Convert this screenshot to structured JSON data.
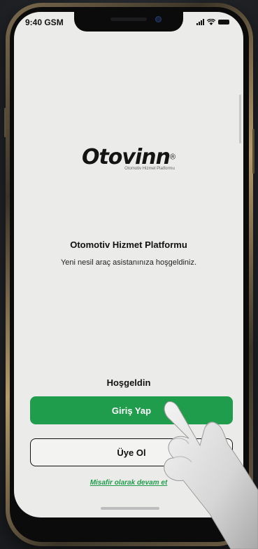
{
  "status_bar": {
    "time": "9:40 GSM"
  },
  "brand": {
    "logo_text": "Otovinn",
    "registered_mark": "®",
    "tagline": "Otomotiv Hizmet Platformu"
  },
  "intro": {
    "title": "Otomotiv Hizmet Platformu",
    "subtitle": "Yeni nesil araç asistanınıza hoşgeldiniz."
  },
  "actions": {
    "welcome_label": "Hoşgeldin",
    "login_label": "Giriş Yap",
    "register_label": "Üye Ol",
    "guest_label": "Misafir olarak devam et"
  },
  "colors": {
    "primary_green": "#1f9d4c",
    "screen_bg": "#ebebea",
    "frame_gold": "#b59a6a"
  },
  "icons": {
    "status": [
      "cellular-signal-icon",
      "wifi-icon",
      "battery-icon"
    ]
  }
}
